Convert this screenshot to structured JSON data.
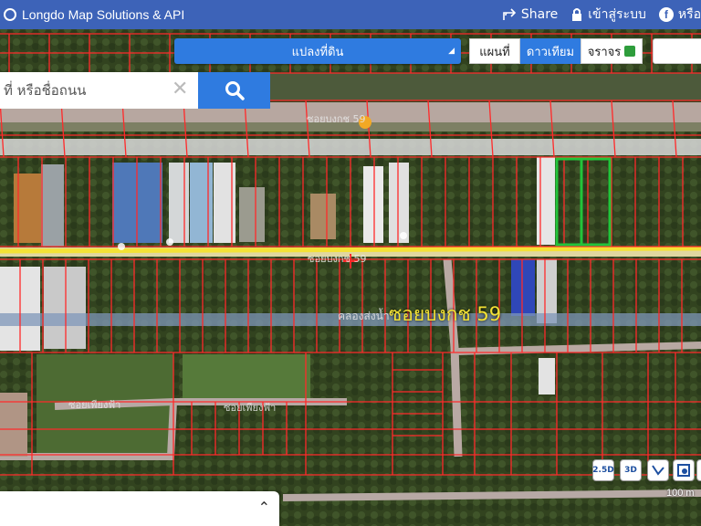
{
  "header": {
    "brand": "Longdo Map Solutions & API",
    "share_label": "Share",
    "login_label": "เข้าสู่ระบบ",
    "or_label": "หรือ",
    "icons": [
      "globe-icon",
      "share-icon",
      "lock-icon",
      "facebook-icon"
    ]
  },
  "layer_select": {
    "selected": "แปลงที่ดิน"
  },
  "map_type": {
    "buttons": [
      "แผนที่",
      "ดาวเทียม",
      "จราจร"
    ],
    "active": "ดาวเทียม"
  },
  "search": {
    "placeholder": "ที่ หรือชื่อถนน",
    "value": ""
  },
  "map": {
    "road_label_main": "ซอยบงกช 59",
    "road_label_canal": "คลองส่งน้ำ",
    "road_label_left": "ซอยเพียงฟ้า",
    "road_label_mid": "ซอยเพียงฟ้า",
    "road_label_top": "ซอยบงกช 59",
    "parcel_color": "#ff2a2a",
    "highlight_color": "#22c43a",
    "road_color": "#f4e235"
  },
  "controls": {
    "buttons": [
      "2.5D",
      "3D",
      "ruler-icon",
      "measure-icon",
      "grid-icon"
    ],
    "scale": "100 m"
  }
}
